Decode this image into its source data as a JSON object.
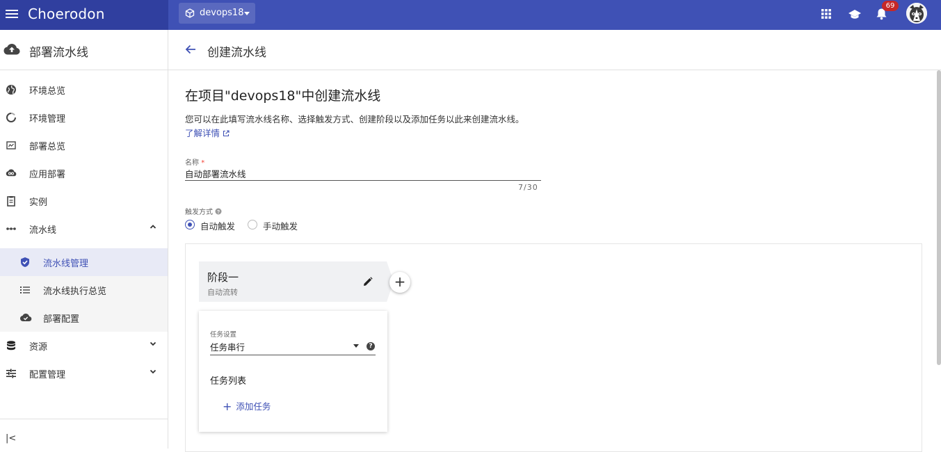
{
  "header": {
    "brand": "Choerodon",
    "project": "devops18",
    "notification_count": "69",
    "icons": [
      "menu-icon",
      "cube-icon",
      "apps-grid-icon",
      "school-icon",
      "bell-icon"
    ]
  },
  "sidebar": {
    "title": "部署流水线",
    "items": [
      {
        "label": "环境总览",
        "icon": "globe-icon"
      },
      {
        "label": "环境管理",
        "icon": "refresh-circle-icon"
      },
      {
        "label": "部署总览",
        "icon": "dashboard-icon"
      },
      {
        "label": "应用部署",
        "icon": "cloud-link-icon"
      },
      {
        "label": "实例",
        "icon": "clipboard-icon"
      },
      {
        "label": "流水线",
        "icon": "dots-icon",
        "expanded": true
      }
    ],
    "sub_items": [
      {
        "label": "流水线管理",
        "icon": "shield-icon",
        "active": true
      },
      {
        "label": "流水线执行总览",
        "icon": "list-icon"
      },
      {
        "label": "部署配置",
        "icon": "cloud-check-icon"
      }
    ],
    "groups": [
      {
        "label": "资源",
        "icon": "database-icon"
      },
      {
        "label": "配置管理",
        "icon": "tune-icon"
      }
    ],
    "collapse_glyph": "|<"
  },
  "page": {
    "title": "创建流水线",
    "heading": "在项目\"devops18\"中创建流水线",
    "description": "您可以在此填写流水线名称、选择触发方式、创建阶段以及添加任务以此来创建流水线。",
    "learn_more": "了解详情"
  },
  "form": {
    "name_label": "名称",
    "name_required": "*",
    "name_value": "自动部署流水线",
    "counter": "7/30",
    "trigger_label": "触发方式",
    "trigger_options": [
      {
        "label": "自动触发",
        "selected": true
      },
      {
        "label": "手动触发",
        "selected": false
      }
    ]
  },
  "stage": {
    "name": "阶段一",
    "sub": "自动流转",
    "task_setting_label": "任务设置",
    "task_setting_value": "任务串行",
    "help_glyph": "?",
    "task_list_title": "任务列表",
    "add_task_glyph": "+",
    "add_task_label": "添加任务",
    "add_stage_glyph": "+"
  },
  "colors": {
    "primary": "#3f51b5",
    "primary_dark": "#303f9f",
    "badge": "#c62828",
    "active_bg": "#e8eaf6"
  }
}
